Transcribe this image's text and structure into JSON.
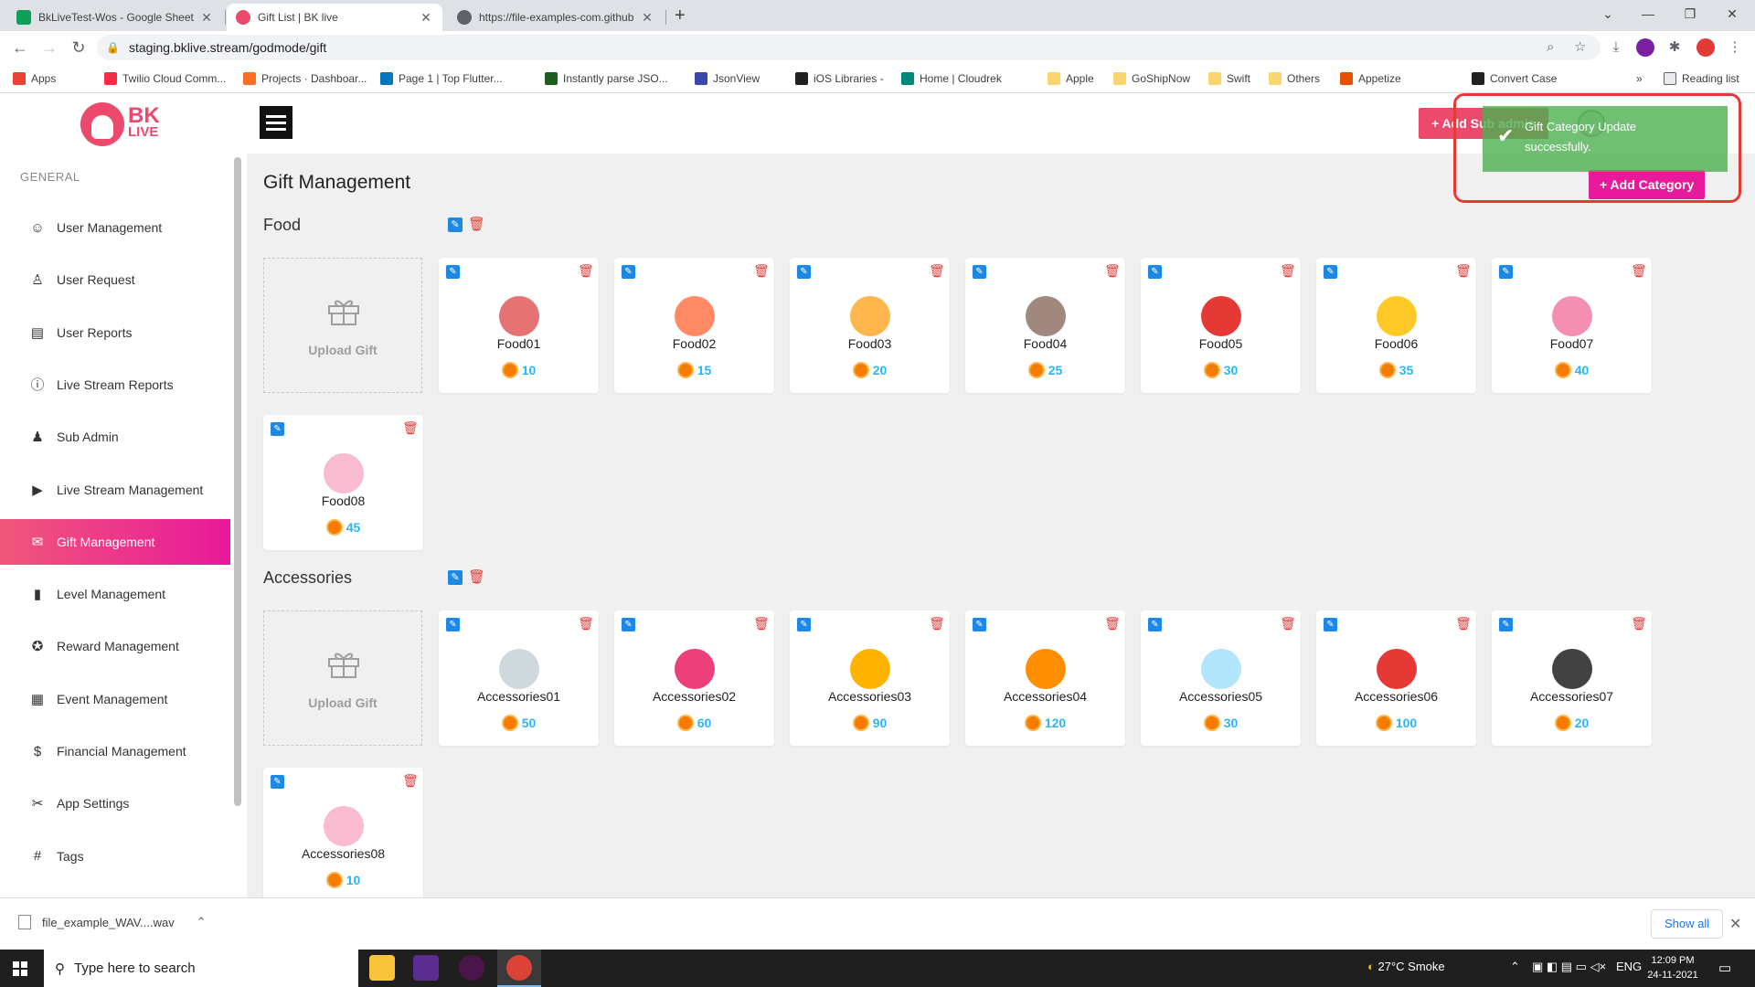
{
  "browser": {
    "tabs": [
      {
        "title": "BkLiveTest-Wos - Google Sheets",
        "color": "#0f9d58"
      },
      {
        "title": "Gift List | BK live",
        "color": "#ec4a6d"
      },
      {
        "title": "https://file-examples-com.github.",
        "color": "#5f6368"
      }
    ],
    "url": "staging.bklive.stream/godmode/gift",
    "bookmarks": [
      {
        "label": "Apps",
        "color": "#ea4335"
      },
      {
        "label": "Twilio Cloud Comm...",
        "color": "#f22f46"
      },
      {
        "label": "Projects · Dashboar...",
        "color": "#fc6d26"
      },
      {
        "label": "Page 1 | Top Flutter...",
        "color": "#0277bd"
      },
      {
        "label": "Instantly parse JSO...",
        "color": "#1b5e20"
      },
      {
        "label": "JsonView",
        "color": "#3949ab"
      },
      {
        "label": "iOS Libraries -",
        "color": "#212121"
      },
      {
        "label": "Home | Cloudrek",
        "color": "#00897b"
      },
      {
        "label": "Apple",
        "color": "#f9d66e"
      },
      {
        "label": "GoShipNow",
        "color": "#f9d66e"
      },
      {
        "label": "Swift",
        "color": "#f9d66e"
      },
      {
        "label": "Others",
        "color": "#f9d66e"
      },
      {
        "label": "Appetize",
        "color": "#e65100"
      },
      {
        "label": "Convert Case",
        "color": "#222222"
      }
    ],
    "reading_list": "Reading list"
  },
  "app": {
    "logo_line1": "BK",
    "logo_line2": "LIVE",
    "section_label": "GENERAL",
    "menu": [
      {
        "label": "User Management",
        "icon": "user-icon"
      },
      {
        "label": "User Request",
        "icon": "user-request-icon"
      },
      {
        "label": "User Reports",
        "icon": "report-icon"
      },
      {
        "label": "Live Stream Reports",
        "icon": "alert-icon"
      },
      {
        "label": "Sub Admin",
        "icon": "admin-icon"
      },
      {
        "label": "Live Stream Management",
        "icon": "video-icon"
      },
      {
        "label": "Gift Management",
        "icon": "gift-icon"
      },
      {
        "label": "Level Management",
        "icon": "bar-chart-icon"
      },
      {
        "label": "Reward Management",
        "icon": "award-icon"
      },
      {
        "label": "Event Management",
        "icon": "event-icon"
      },
      {
        "label": "Financial Management",
        "icon": "dollar-icon"
      },
      {
        "label": "App Settings",
        "icon": "tools-icon"
      },
      {
        "label": "Tags",
        "icon": "hash-icon"
      }
    ],
    "active_menu": "Gift Management",
    "add_sub_admin": "+ Add Sub admin",
    "page_title": "Gift Management",
    "add_category": "+ Add Category",
    "upload_label": "Upload Gift",
    "toast_line1": "Gift Category Update",
    "toast_line2": "successfully.",
    "categories": [
      {
        "name": "Food",
        "gifts": [
          {
            "name": "Food01",
            "price": "10",
            "color": "#e57373"
          },
          {
            "name": "Food02",
            "price": "15",
            "color": "#ff8a65"
          },
          {
            "name": "Food03",
            "price": "20",
            "color": "#ffb74d"
          },
          {
            "name": "Food04",
            "price": "25",
            "color": "#a1887f"
          },
          {
            "name": "Food05",
            "price": "30",
            "color": "#e53935"
          },
          {
            "name": "Food06",
            "price": "35",
            "color": "#ffca28"
          },
          {
            "name": "Food07",
            "price": "40",
            "color": "#f48fb1"
          },
          {
            "name": "Food08",
            "price": "45",
            "color": "#f8bbd0"
          }
        ]
      },
      {
        "name": "Accessories",
        "gifts": [
          {
            "name": "Accessories01",
            "price": "50",
            "color": "#cfd8dc"
          },
          {
            "name": "Accessories02",
            "price": "60",
            "color": "#ec407a"
          },
          {
            "name": "Accessories03",
            "price": "90",
            "color": "#ffb300"
          },
          {
            "name": "Accessories04",
            "price": "120",
            "color": "#ff8f00"
          },
          {
            "name": "Accessories05",
            "price": "30",
            "color": "#b3e5fc"
          },
          {
            "name": "Accessories06",
            "price": "100",
            "color": "#e53935"
          },
          {
            "name": "Accessories07",
            "price": "20",
            "color": "#424242"
          },
          {
            "name": "Accessories08",
            "price": "10",
            "color": "#f8bbd0"
          }
        ]
      }
    ]
  },
  "downloads": {
    "file": "file_example_WAV....wav",
    "show_all": "Show all"
  },
  "taskbar": {
    "search_placeholder": "Type here to search",
    "weather": "27°C  Smoke",
    "lang": "ENG",
    "time": "12:09 PM",
    "date": "24-11-2021"
  },
  "colors": {
    "brand": "#ec4a6d",
    "accent": "#e8199a",
    "price": "#29b6f6",
    "toast": "#4caf50",
    "edit": "#1e88e5",
    "delete": "#e53935"
  }
}
